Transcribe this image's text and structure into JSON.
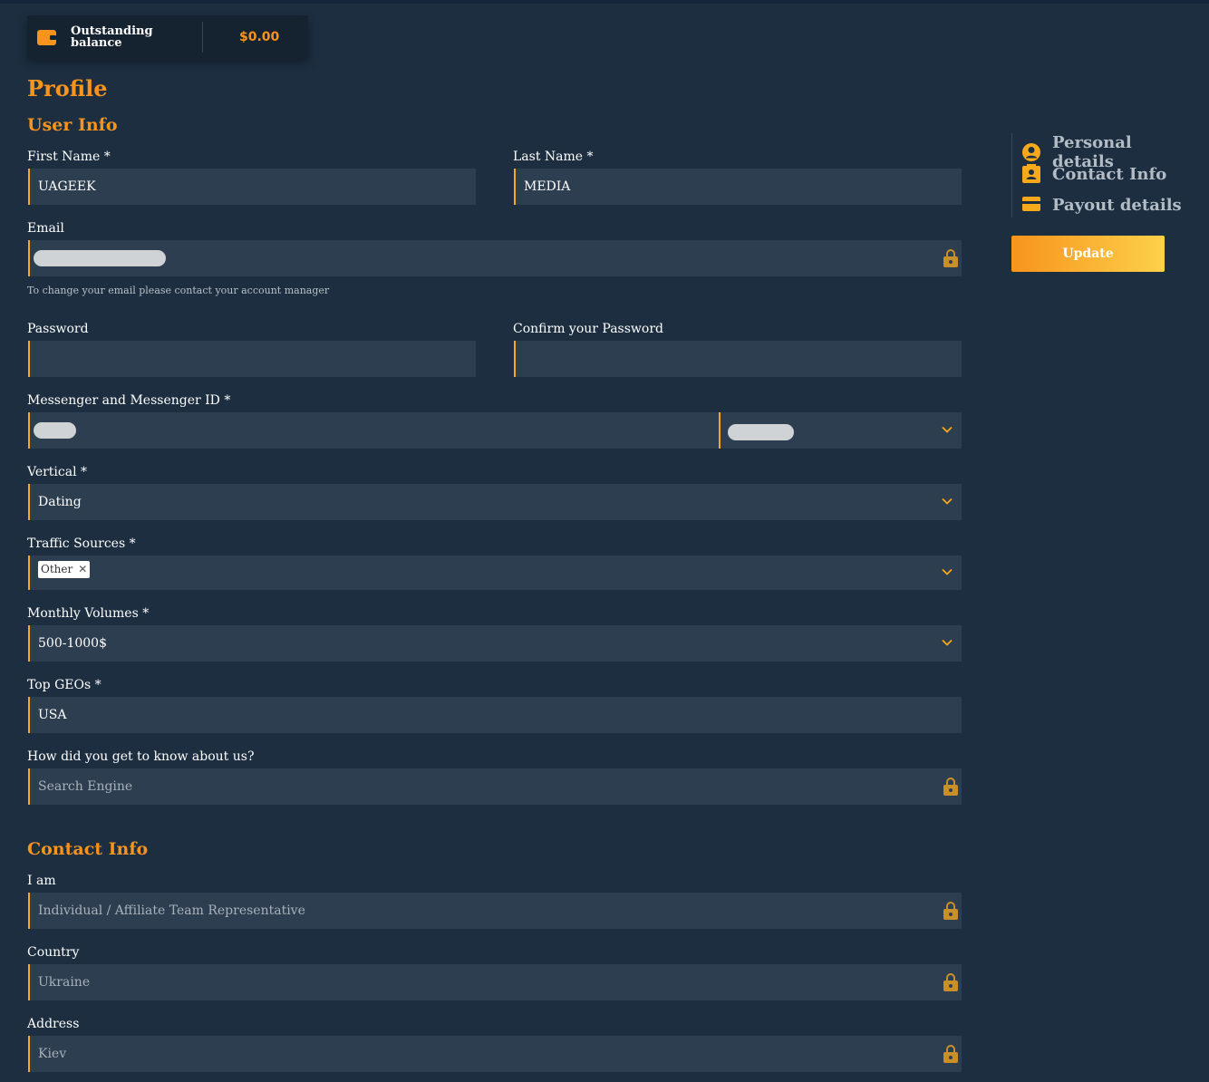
{
  "balance": {
    "label": "Outstanding balance",
    "value": "$0.00"
  },
  "page_title": "Profile",
  "sections": {
    "user_info": "User Info",
    "contact_info": "Contact Info"
  },
  "fields": {
    "first_name": {
      "label": "First Name *",
      "value": "UAGEEK"
    },
    "last_name": {
      "label": "Last Name *",
      "value": "MEDIA"
    },
    "email": {
      "label": "Email",
      "hint": "To change your email please contact your account manager"
    },
    "password": {
      "label": "Password",
      "value": ""
    },
    "confirm_password": {
      "label": "Confirm your Password",
      "value": ""
    },
    "messenger": {
      "label": "Messenger and Messenger ID *"
    },
    "vertical": {
      "label": "Vertical *",
      "value": "Dating"
    },
    "traffic_sources": {
      "label": "Traffic Sources *",
      "tags": [
        "Other"
      ],
      "remove_glyph": "✕"
    },
    "monthly_volumes": {
      "label": "Monthly Volumes *",
      "value": "500-1000$"
    },
    "top_geos": {
      "label": "Top GEOs *",
      "value": "USA"
    },
    "how_know": {
      "label": "How did you get to know about us?",
      "value": "Search Engine"
    },
    "i_am": {
      "label": "I am",
      "value": "Individual / Affiliate Team Representative"
    },
    "country": {
      "label": "Country",
      "value": "Ukraine"
    },
    "address": {
      "label": "Address",
      "value": "Kiev"
    }
  },
  "side_nav": {
    "items": [
      {
        "label": "Personal details",
        "icon": "user-circle-icon"
      },
      {
        "label": "Contact Info",
        "icon": "contact-card-icon"
      },
      {
        "label": "Payout details",
        "icon": "credit-card-icon"
      }
    ]
  },
  "update_button": "Update",
  "colors": {
    "accent": "#f7941d",
    "background": "#1c2e40",
    "field_bg": "#2d3e50",
    "lock": "#c9902a"
  }
}
